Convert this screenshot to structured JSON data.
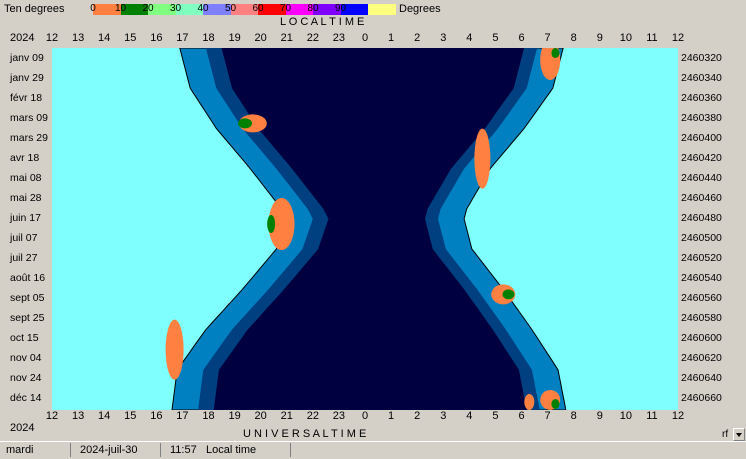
{
  "legend": {
    "title": "Ten degrees",
    "unit": "Degrees",
    "items": [
      {
        "label": "0",
        "color": "#ff8040"
      },
      {
        "label": "10",
        "color": "#008000"
      },
      {
        "label": "20",
        "color": "#80ff80"
      },
      {
        "label": "30",
        "color": "#80ffc0"
      },
      {
        "label": "40",
        "color": "#8080ff"
      },
      {
        "label": "50",
        "color": "#ff8080"
      },
      {
        "label": "60",
        "color": "#ff0000"
      },
      {
        "label": "70",
        "color": "#ff00ff"
      },
      {
        "label": "80",
        "color": "#8000ff"
      },
      {
        "label": "90",
        "color": "#0000ff"
      }
    ],
    "last_color": "#ffff80"
  },
  "header": {
    "top_label": "L O C A L    T I M E",
    "bottom_label": "U N I V E R S A L    T I M E",
    "year_top": "2024",
    "year_bottom": "2024"
  },
  "status": {
    "day": "mardi",
    "date": "2024-juil-30",
    "time": "11:57",
    "mode": "Local time",
    "corner": "rf"
  },
  "chart_data": {
    "type": "area",
    "x_ticks_top": [
      "12",
      "13",
      "14",
      "15",
      "16",
      "17",
      "18",
      "19",
      "20",
      "21",
      "22",
      "23",
      "0",
      "1",
      "2",
      "3",
      "4",
      "5",
      "6",
      "7",
      "8",
      "9",
      "10",
      "11",
      "12"
    ],
    "x_ticks_bottom": [
      "12",
      "13",
      "14",
      "15",
      "16",
      "17",
      "18",
      "19",
      "20",
      "21",
      "22",
      "23",
      "0",
      "1",
      "2",
      "3",
      "4",
      "5",
      "6",
      "7",
      "8",
      "9",
      "10",
      "11",
      "12"
    ],
    "date_labels": [
      "janv 09",
      "janv 29",
      "févr 18",
      "mars 09",
      "mars 29",
      "avr 18",
      "mai 08",
      "mai 28",
      "juin 17",
      "juil 07",
      "juil 27",
      "août 16",
      "sept 05",
      "sept 25",
      "oct 15",
      "nov 04",
      "nov 24",
      "déc 14"
    ],
    "jd_labels": [
      "2460320",
      "2460340",
      "2460360",
      "2460380",
      "2460400",
      "2460420",
      "2460440",
      "2460460",
      "2460480",
      "2460500",
      "2460520",
      "2460540",
      "2460560",
      "2460580",
      "2460600",
      "2460620",
      "2460640",
      "2460660"
    ],
    "colors": {
      "day": "#80ffff",
      "civil": "#0080c0",
      "nautical": "#004080",
      "night": "#000040",
      "sun_low": "#ff8040",
      "sun_10": "#008000"
    },
    "night_band": {
      "y_days": [
        0,
        40,
        80,
        120,
        160,
        170,
        200,
        240,
        280,
        320,
        360
      ],
      "sunset_outer": [
        16.9,
        17.3,
        18.3,
        19.6,
        20.8,
        21.0,
        20.6,
        19.3,
        17.9,
        16.8,
        16.6
      ],
      "sunrise_outer": [
        7.6,
        7.2,
        6.1,
        4.8,
        3.9,
        3.8,
        4.1,
        5.3,
        6.4,
        7.4,
        7.7
      ]
    }
  }
}
